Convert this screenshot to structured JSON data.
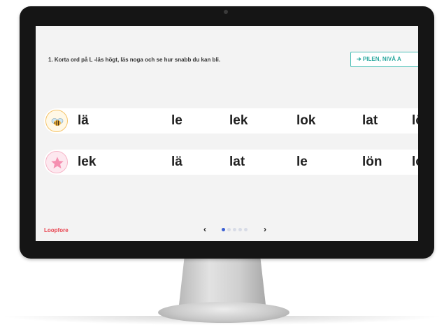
{
  "exercise": {
    "instruction": "1. Korta ord på L -läs högt, läs noga och se hur snabb du kan bli.",
    "nav_button_label": "➔ PILEN, NIVÅ A"
  },
  "rows": [
    {
      "icon": "bee-icon",
      "words": [
        "lä",
        "le",
        "lek",
        "lok",
        "lat",
        "lön"
      ]
    },
    {
      "icon": "star-icon",
      "words": [
        "lek",
        "lä",
        "lat",
        "le",
        "lön",
        "lok"
      ]
    }
  ],
  "footer": {
    "brand": "Loopfore",
    "prev_label": "‹",
    "next_label": "›",
    "page_count": 5,
    "active_page": 1
  },
  "colors": {
    "accent": "#2aa89e",
    "brand": "#e8434f",
    "active_dot": "#3b5fd3"
  }
}
